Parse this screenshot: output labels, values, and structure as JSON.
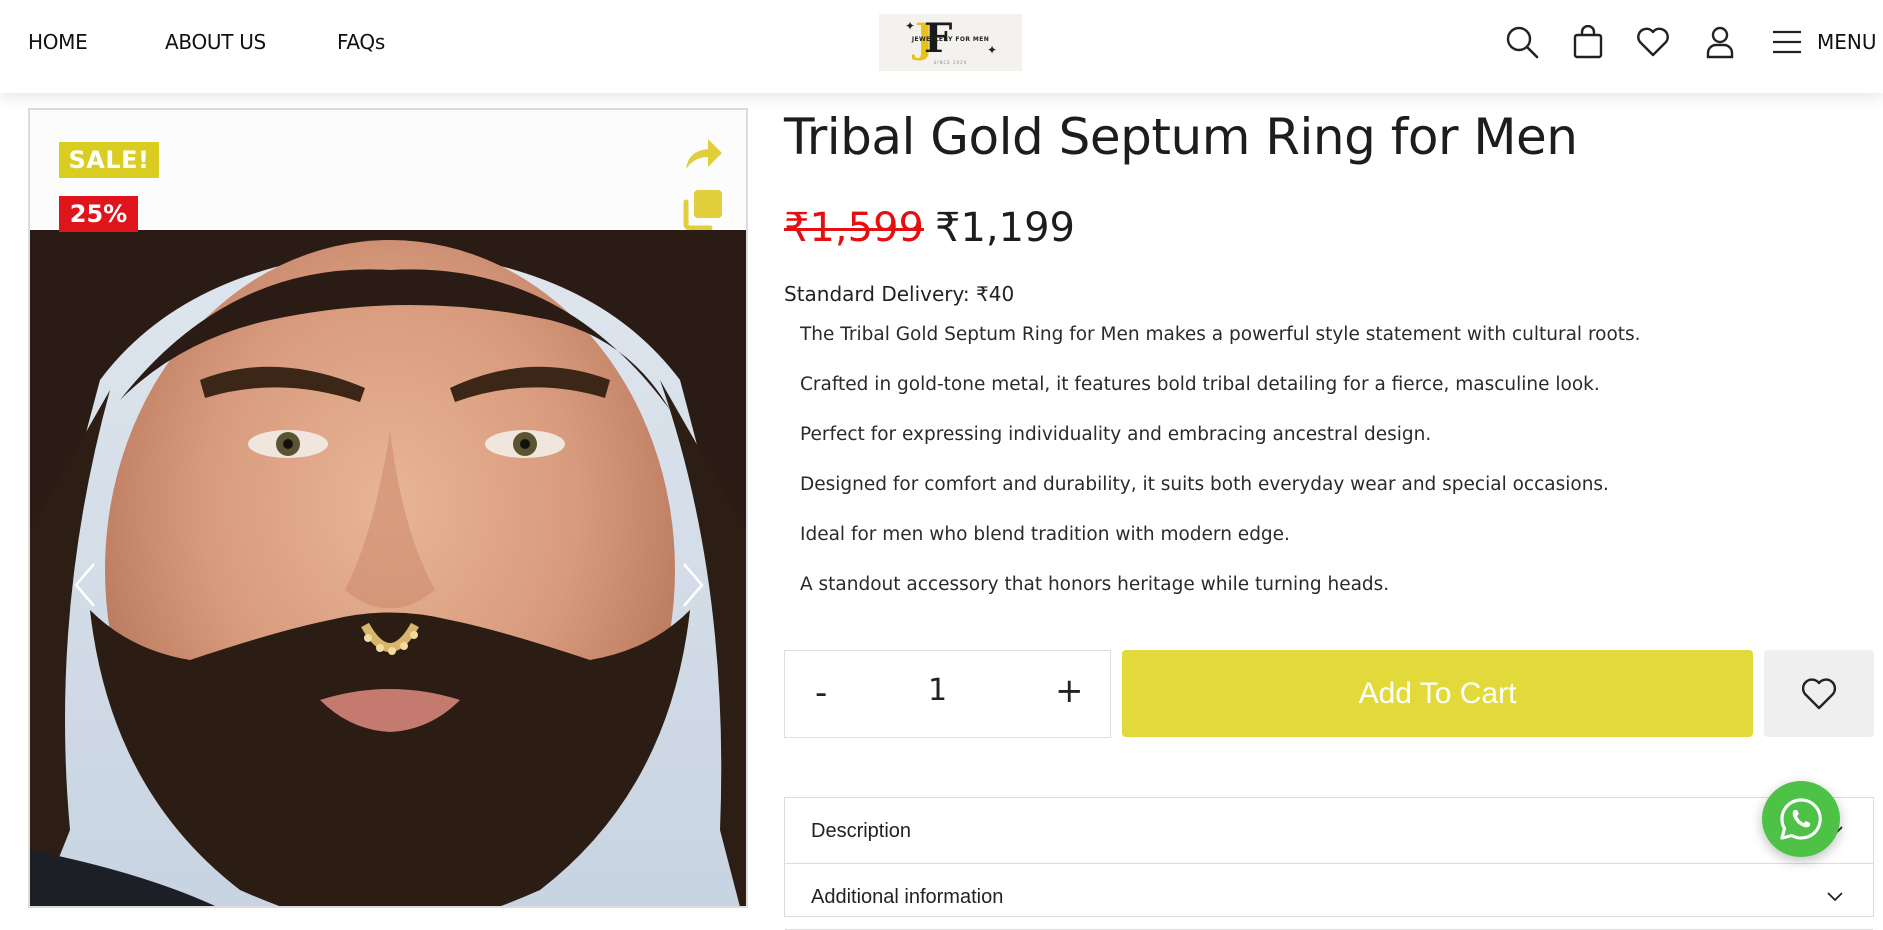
{
  "header": {
    "nav": [
      "HOME",
      "ABOUT US",
      "FAQs"
    ],
    "logo": {
      "letters_j": "J",
      "letters_f": "F",
      "text": "JEWELLERY FOR MEN",
      "since": "SINCE 2020"
    },
    "icons": [
      "search-icon",
      "bag-icon",
      "heart-icon",
      "user-icon",
      "hamburger-icon"
    ],
    "menu_label": "MENU"
  },
  "gallery": {
    "badge_sale": "SALE!",
    "badge_discount": "25%",
    "icons": [
      "share-icon",
      "copy-icon",
      "chevron-left-icon",
      "chevron-right-icon"
    ],
    "accent_color": "#e0cf3a"
  },
  "product": {
    "title": "Tribal Gold Septum Ring for Men",
    "old_price": "₹1,599",
    "new_price": "₹1,199",
    "delivery": "Standard Delivery: ₹40",
    "bullets": [
      "The Tribal Gold Septum Ring for Men makes a powerful style statement with cultural roots.",
      "Crafted in gold-tone metal, it features bold tribal detailing for a fierce, masculine look.",
      "Perfect for expressing individuality and embracing ancestral design.",
      "Designed for comfort and durability, it suits both everyday wear and special occasions.",
      "Ideal for men who blend tradition with modern edge.",
      "A standout accessory that honors heritage while turning heads."
    ]
  },
  "purchase": {
    "minus": "-",
    "quantity": "1",
    "plus": "+",
    "add_to_cart": "Add To Cart",
    "button_color": "#e2da3a"
  },
  "accordion": {
    "items": [
      "Description",
      "Additional information"
    ]
  },
  "colors": {
    "sale_badge": "#d9cd21",
    "discount_badge": "#e0141b",
    "old_price": "#e60f0f",
    "whatsapp": "#4dc247"
  }
}
